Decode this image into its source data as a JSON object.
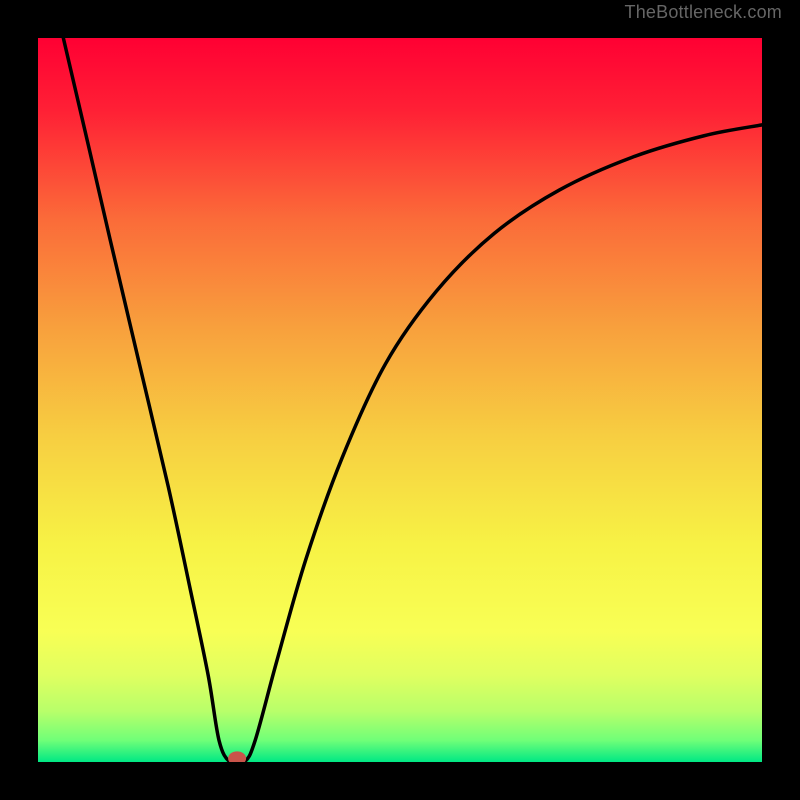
{
  "watermark": "TheBottleneck.com",
  "chart_data": {
    "type": "line-over-heatmap",
    "title": "",
    "x_range": [
      0,
      100
    ],
    "y_range": [
      0,
      100
    ],
    "background_stops": [
      {
        "offset": 0.0,
        "color": "#ff0033"
      },
      {
        "offset": 0.1,
        "color": "#ff2035"
      },
      {
        "offset": 0.25,
        "color": "#fb6b39"
      },
      {
        "offset": 0.4,
        "color": "#f8a03d"
      },
      {
        "offset": 0.55,
        "color": "#f7ce41"
      },
      {
        "offset": 0.7,
        "color": "#f7f245"
      },
      {
        "offset": 0.82,
        "color": "#f8ff55"
      },
      {
        "offset": 0.88,
        "color": "#e0ff60"
      },
      {
        "offset": 0.93,
        "color": "#b8ff6a"
      },
      {
        "offset": 0.97,
        "color": "#70ff78"
      },
      {
        "offset": 1.0,
        "color": "#00e884"
      }
    ],
    "curve_points": [
      {
        "x": 3.5,
        "y": 100.0
      },
      {
        "x": 7.0,
        "y": 85.0
      },
      {
        "x": 10.0,
        "y": 72.0
      },
      {
        "x": 14.0,
        "y": 55.0
      },
      {
        "x": 18.0,
        "y": 38.0
      },
      {
        "x": 21.0,
        "y": 24.0
      },
      {
        "x": 23.5,
        "y": 12.0
      },
      {
        "x": 25.0,
        "y": 3.0
      },
      {
        "x": 26.5,
        "y": 0.0
      },
      {
        "x": 28.5,
        "y": 0.0
      },
      {
        "x": 30.0,
        "y": 3.0
      },
      {
        "x": 33.0,
        "y": 14.0
      },
      {
        "x": 37.0,
        "y": 28.0
      },
      {
        "x": 42.0,
        "y": 42.0
      },
      {
        "x": 48.0,
        "y": 55.0
      },
      {
        "x": 55.0,
        "y": 65.0
      },
      {
        "x": 63.0,
        "y": 73.0
      },
      {
        "x": 72.0,
        "y": 79.0
      },
      {
        "x": 82.0,
        "y": 83.5
      },
      {
        "x": 92.0,
        "y": 86.5
      },
      {
        "x": 100.0,
        "y": 88.0
      }
    ],
    "marker": {
      "x": 27.5,
      "y": 0.5,
      "color": "#c9544a"
    },
    "frame_color": "#000000",
    "frame_thickness_px": 38,
    "curve_color": "#000000"
  }
}
